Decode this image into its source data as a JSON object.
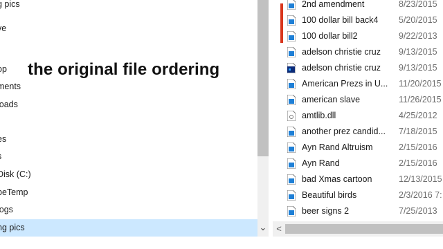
{
  "overlay": {
    "caption": "the original file ordering"
  },
  "nav": {
    "items": [
      {
        "label": "g pics",
        "selected": false
      },
      {
        "label": "ve",
        "selected": false
      },
      {
        "label": "",
        "selected": false
      },
      {
        "label": "op",
        "selected": false
      },
      {
        "label": "ments",
        "selected": false
      },
      {
        "label": "loads",
        "selected": false
      },
      {
        "label": "",
        "selected": false
      },
      {
        "label": "es",
        "selected": false
      },
      {
        "label": "s",
        "selected": false
      },
      {
        "label": "Disk (C:)",
        "selected": false
      },
      {
        "label": "beTemp",
        "selected": false
      },
      {
        "label": "logs",
        "selected": false
      },
      {
        "label": "ng pics",
        "selected": true
      }
    ],
    "scroll_down_glyph": "⌄"
  },
  "files": {
    "rows": [
      {
        "name": "2nd amendment",
        "date": "8/23/2015",
        "icon": "image-file-icon",
        "marked": false
      },
      {
        "name": "100 dollar bill back4",
        "date": "5/20/2015",
        "icon": "image-file-icon",
        "marked": true
      },
      {
        "name": "100 dollar bill2",
        "date": "9/22/2013",
        "icon": "image-file-icon",
        "marked": true
      },
      {
        "name": "adelson christie cruz",
        "date": "9/13/2015",
        "icon": "image-file-icon",
        "marked": false
      },
      {
        "name": "adelson christie cruz",
        "date": "9/13/2015",
        "icon": "photoshop-file-icon",
        "marked": false
      },
      {
        "name": "American Prezs in U...",
        "date": "11/20/2015",
        "icon": "image-file-icon",
        "marked": false
      },
      {
        "name": "american slave",
        "date": "11/26/2015",
        "icon": "image-file-icon",
        "marked": false
      },
      {
        "name": "amtlib.dll",
        "date": "4/25/2012",
        "icon": "dll-file-icon",
        "marked": false
      },
      {
        "name": "another prez candid...",
        "date": "7/18/2015",
        "icon": "image-file-icon",
        "marked": false
      },
      {
        "name": "Ayn Rand Altruism",
        "date": "2/15/2016",
        "icon": "image-file-icon",
        "marked": false
      },
      {
        "name": "Ayn Rand",
        "date": "2/15/2016",
        "icon": "image-file-icon",
        "marked": false
      },
      {
        "name": "bad Xmas cartoon",
        "date": "12/13/2015",
        "icon": "image-file-icon",
        "marked": false
      },
      {
        "name": "Beautiful birds",
        "date": "2/3/2016 7:",
        "icon": "image-file-icon",
        "marked": false
      },
      {
        "name": "beer signs 2",
        "date": "7/25/2013",
        "icon": "image-file-icon",
        "marked": false
      }
    ]
  },
  "hscroll": {
    "left_glyph": "<"
  },
  "colors": {
    "selected_bg": "#cce8ff",
    "marker_red": "#d9361d",
    "image_icon_blue": "#1e7fd6",
    "photoshop_icon_blue": "#0b2a78"
  }
}
